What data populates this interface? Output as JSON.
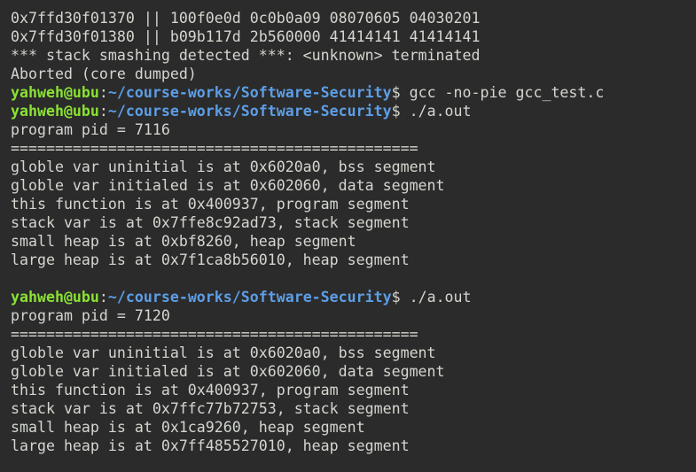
{
  "colors": {
    "background": "#2b2b2b",
    "text": "#d3d7cf",
    "prompt_user": "#8ae234",
    "prompt_path": "#5c9ee6"
  },
  "prompt": {
    "user_host": "yahweh@ubu",
    "colon": ":",
    "path": "~/course-works/Software-Security",
    "dollar": "$ "
  },
  "output_pre": [
    "0x7ffd30f01370 || 100f0e0d 0c0b0a09 08070605 04030201",
    "0x7ffd30f01380 || b09b117d 2b560000 41414141 41414141",
    "*** stack smashing detected ***: <unknown> terminated",
    "Aborted (core dumped)"
  ],
  "commands": {
    "compile": "gcc -no-pie gcc_test.c",
    "run": "./a.out"
  },
  "run1": [
    "program pid = 7116",
    "==============================================",
    "globle var uninitial is at 0x6020a0, bss segment",
    "globle var initialed is at 0x602060, data segment",
    "this function is at 0x400937, program segment",
    "stack var is at 0x7ffe8c92ad73, stack segment",
    "small heap is at 0xbf8260, heap segment",
    "large heap is at 0x7f1ca8b56010, heap segment"
  ],
  "run2": [
    "program pid = 7120",
    "==============================================",
    "globle var uninitial is at 0x6020a0, bss segment",
    "globle var initialed is at 0x602060, data segment",
    "this function is at 0x400937, program segment",
    "stack var is at 0x7ffc77b72753, stack segment",
    "small heap is at 0x1ca9260, heap segment",
    "large heap is at 0x7ff485527010, heap segment"
  ]
}
